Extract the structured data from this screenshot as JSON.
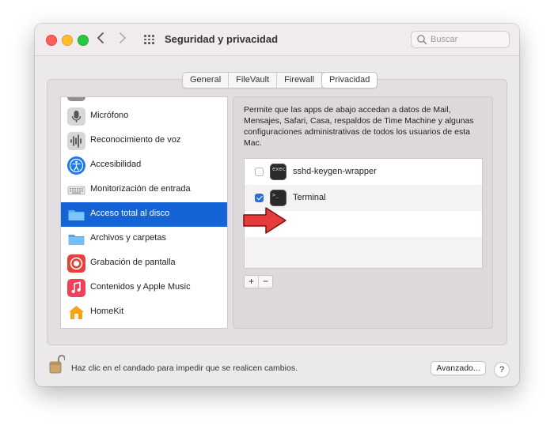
{
  "window": {
    "title": "Seguridad y privacidad"
  },
  "search": {
    "placeholder": "Buscar"
  },
  "tabs": [
    {
      "label": "General",
      "active": false
    },
    {
      "label": "FileVault",
      "active": false
    },
    {
      "label": "Firewall",
      "active": false
    },
    {
      "label": "Privacidad",
      "active": true
    }
  ],
  "sidebar": {
    "items": [
      {
        "label": "Micrófono",
        "icon": "microphone-icon"
      },
      {
        "label": "Reconocimiento de voz",
        "icon": "waveform-icon"
      },
      {
        "label": "Accesibilidad",
        "icon": "accessibility-icon"
      },
      {
        "label": "Monitorización de entrada",
        "icon": "keyboard-icon"
      },
      {
        "label": "Acceso total al disco",
        "icon": "folder-icon",
        "selected": true
      },
      {
        "label": "Archivos y carpetas",
        "icon": "folder-icon"
      },
      {
        "label": "Grabación de pantalla",
        "icon": "screen-record-icon"
      },
      {
        "label": "Contenidos y Apple Music",
        "icon": "music-note-icon"
      },
      {
        "label": "HomeKit",
        "icon": "home-icon"
      }
    ]
  },
  "detail": {
    "description": "Permite que las apps de abajo accedan a datos de Mail, Mensajes, Safari, Casa, respaldos de Time Machine y algunas configuraciones administrativas de todos los usuarios de esta Mac.",
    "apps": [
      {
        "name": "sshd-keygen-wrapper",
        "checked": false
      },
      {
        "name": "Terminal",
        "checked": true
      }
    ],
    "add_label": "+",
    "remove_label": "−"
  },
  "footer": {
    "lock_text": "Haz clic en el candado para impedir que se realicen cambios.",
    "advanced_label": "Avanzado...",
    "help_label": "?"
  },
  "colors": {
    "selection": "#1663d6",
    "checkbox_on": "#2b6fd6",
    "arrow": "#e63b3b"
  }
}
